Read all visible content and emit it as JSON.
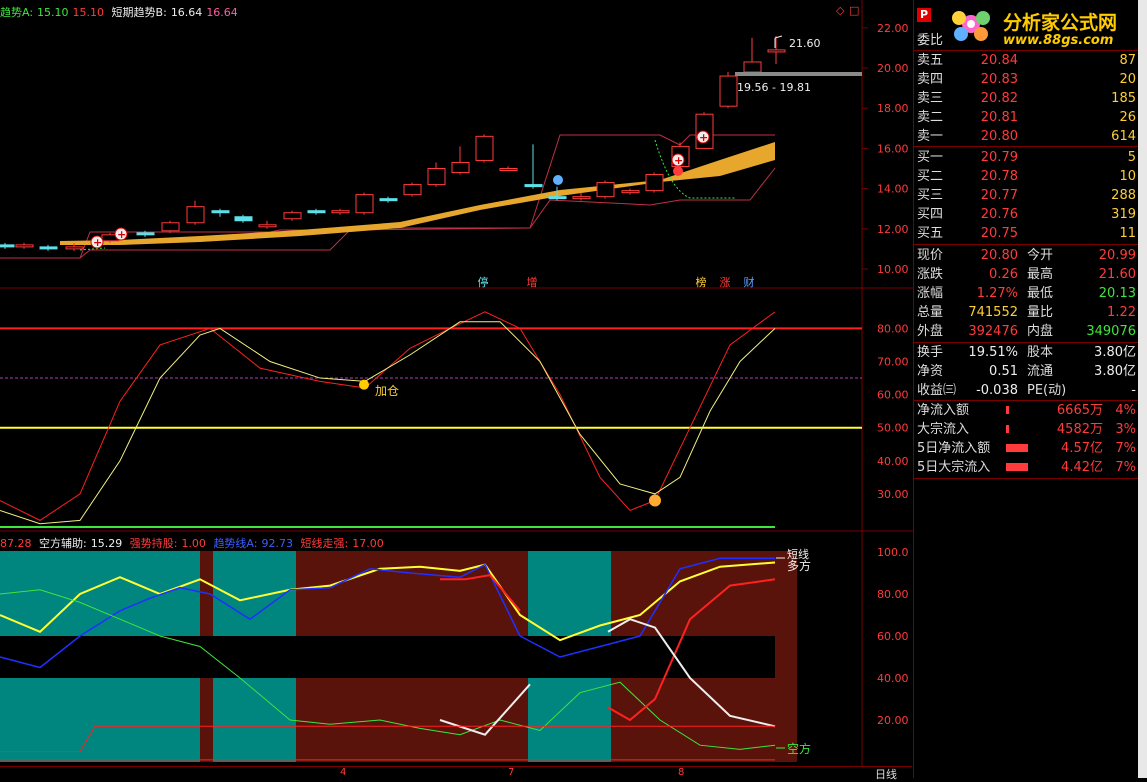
{
  "main": {
    "header": {
      "line_a_label": "趋势A:",
      "line_a_val1": "15.10",
      "line_a_val2": "15.10",
      "line_b_label": "短期趋势B:",
      "line_b_val1": "16.64",
      "line_b_val2": "16.64"
    },
    "price_axis": [
      "22.00",
      "20.00",
      "18.00",
      "16.00",
      "14.00",
      "12.00",
      "10.00"
    ],
    "annotations": {
      "high_label": "21.60",
      "range_label": "19.56 - 19.81"
    },
    "tags": [
      "停",
      "增",
      "榜",
      "涨",
      "财"
    ]
  },
  "kdj": {
    "axis": [
      "80.00",
      "70.00",
      "60.00",
      "50.00",
      "40.00",
      "30.00"
    ],
    "signal_label": "加仓"
  },
  "third": {
    "header": {
      "v0": "87.28",
      "kongfang_label": "空方辅助:",
      "kongfang_val": "15.29",
      "qiangshi_label": "强势持股:",
      "qiangshi_val": "1.00",
      "qushi_label": "趋势线A:",
      "qushi_val": "92.73",
      "duanxian_label": "短线走强:",
      "duanxian_val": "17.00"
    },
    "axis": [
      "100.0",
      "80.00",
      "60.00",
      "40.00",
      "20.00"
    ],
    "labels": {
      "top": "短线",
      "duofang": "多方",
      "kongfang": "空方"
    }
  },
  "date_axis": [
    "4",
    "7",
    "8"
  ],
  "period_label": "日线",
  "panel": {
    "p_icon": "P",
    "logo_text": "分析家公式网",
    "logo_url": "www.88gs.com",
    "weibi_label": "委比",
    "asks": [
      {
        "label": "卖五",
        "price": "20.84",
        "vol": "87"
      },
      {
        "label": "卖四",
        "price": "20.83",
        "vol": "20"
      },
      {
        "label": "卖三",
        "price": "20.82",
        "vol": "185"
      },
      {
        "label": "卖二",
        "price": "20.81",
        "vol": "26"
      },
      {
        "label": "卖一",
        "price": "20.80",
        "vol": "614"
      }
    ],
    "bids": [
      {
        "label": "买一",
        "price": "20.79",
        "vol": "5"
      },
      {
        "label": "买二",
        "price": "20.78",
        "vol": "10"
      },
      {
        "label": "买三",
        "price": "20.77",
        "vol": "288"
      },
      {
        "label": "买四",
        "price": "20.76",
        "vol": "319"
      },
      {
        "label": "买五",
        "price": "20.75",
        "vol": "11"
      }
    ],
    "quote": [
      {
        "l1": "现价",
        "v1": "20.80",
        "l2": "今开",
        "v2": "20.99"
      },
      {
        "l1": "涨跌",
        "v1": "0.26",
        "l2": "最高",
        "v2": "21.60"
      },
      {
        "l1": "涨幅",
        "v1": "1.27%",
        "l2": "最低",
        "v2": "20.13"
      },
      {
        "l1": "总量",
        "v1": "741552",
        "l2": "量比",
        "v2": "1.22"
      },
      {
        "l1": "外盘",
        "v1": "392476",
        "l2": "内盘",
        "v2": "349076"
      }
    ],
    "stats": [
      {
        "l1": "换手",
        "v1": "19.51%",
        "l2": "股本",
        "v2": "3.80亿"
      },
      {
        "l1": "净资",
        "v1": "0.51",
        "l2": "流通",
        "v2": "3.80亿"
      },
      {
        "l1": "收益㈢",
        "v1": "-0.038",
        "l2": "PE(动)",
        "v2": "-"
      }
    ],
    "flows": [
      {
        "label": "净流入额",
        "amount": "6665万",
        "pct": "4%"
      },
      {
        "label": "大宗流入",
        "amount": "4582万",
        "pct": "3%"
      },
      {
        "label": "5日净流入额",
        "amount": "4.57亿",
        "pct": "7%"
      },
      {
        "label": "5日大宗流入",
        "amount": "4.42亿",
        "pct": "7%"
      }
    ]
  },
  "colors": {
    "up": "#ff3b3b",
    "down": "#3ee53e",
    "cyan": "#5fe0e8",
    "gold": "#e7a62c",
    "teal": "#00857f",
    "maroon": "#5a130a",
    "yellow": "#ffff33"
  }
}
